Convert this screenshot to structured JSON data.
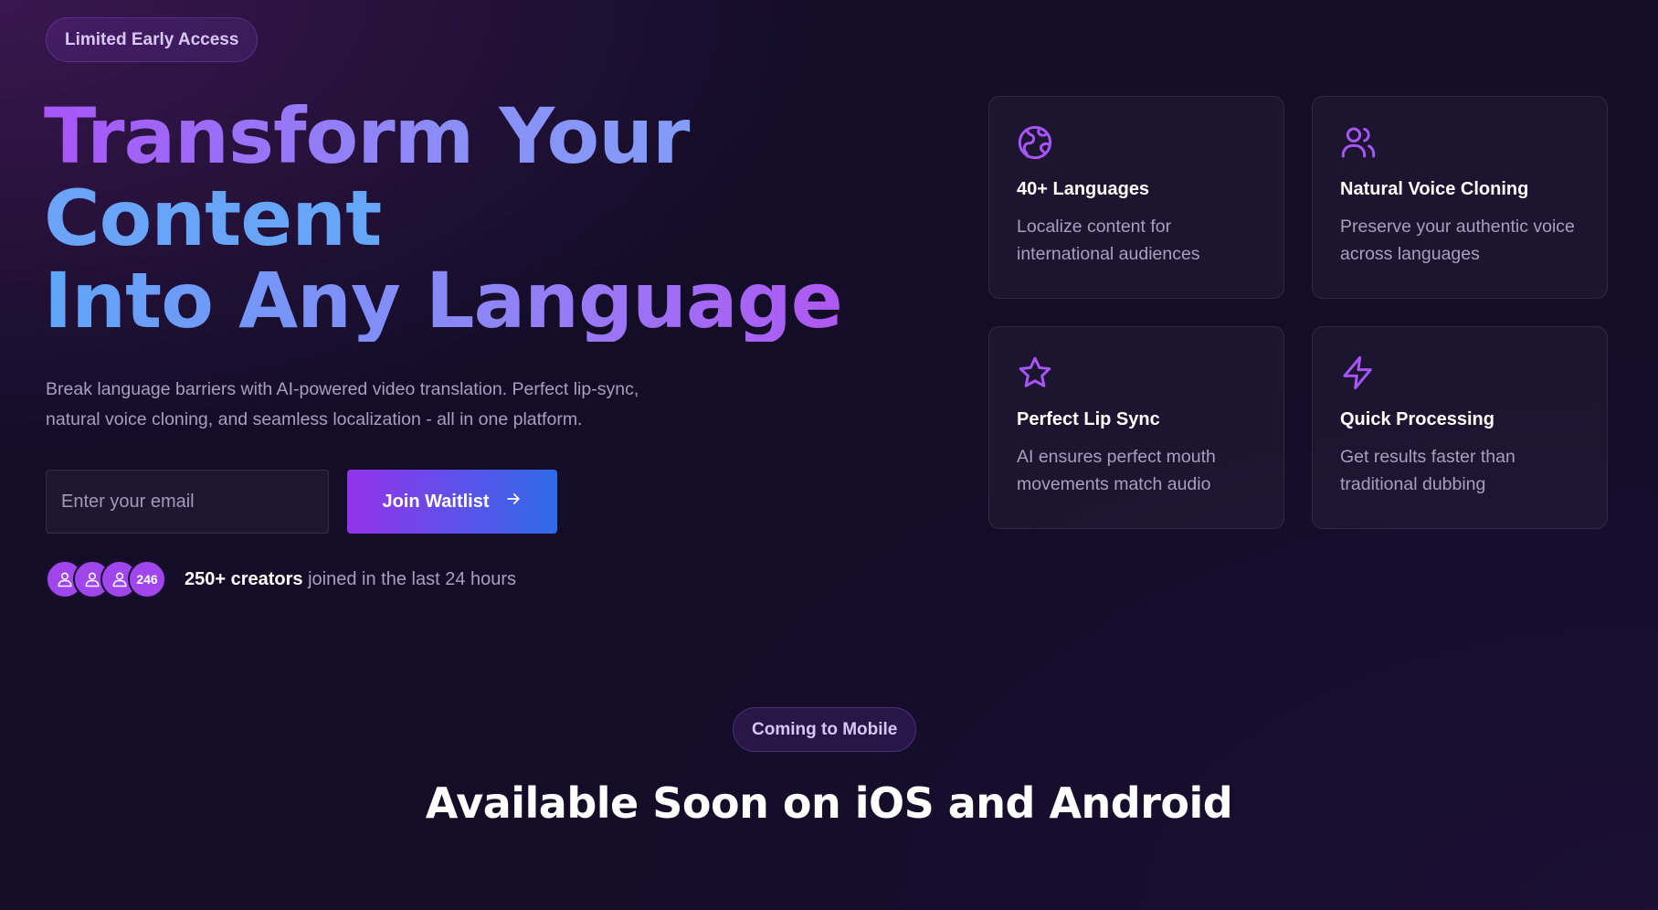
{
  "badges": {
    "early_access": "Limited Early Access",
    "mobile": "Coming to Mobile"
  },
  "hero": {
    "title_line1": "Transform Your",
    "title_line2": "Content",
    "title_line3": "Into Any Language",
    "description": "Break language barriers with AI-powered video translation. Perfect lip-sync, natural voice cloning, and seamless localization - all in one platform."
  },
  "waitlist": {
    "email_placeholder": "Enter your email",
    "email_value": "",
    "button_label": "Join Waitlist"
  },
  "social_proof": {
    "avatar_count": "246",
    "highlight": "250+ creators",
    "text": "joined in the last 24 hours"
  },
  "features": [
    {
      "icon": "globe-icon",
      "title": "40+ Languages",
      "description": "Localize content for international audiences"
    },
    {
      "icon": "users-icon",
      "title": "Natural Voice Cloning",
      "description": "Preserve your authentic voice across languages"
    },
    {
      "icon": "star-icon",
      "title": "Perfect Lip Sync",
      "description": "AI ensures perfect mouth movements match audio"
    },
    {
      "icon": "lightning-icon",
      "title": "Quick Processing",
      "description": "Get results faster than traditional dubbing"
    }
  ],
  "mobile": {
    "title": "Available Soon on iOS and Android"
  },
  "colors": {
    "background": "#130d28",
    "accent_purple": "#a855f7",
    "accent_blue": "#2f6be8",
    "muted_text": "#a6a0bd"
  }
}
